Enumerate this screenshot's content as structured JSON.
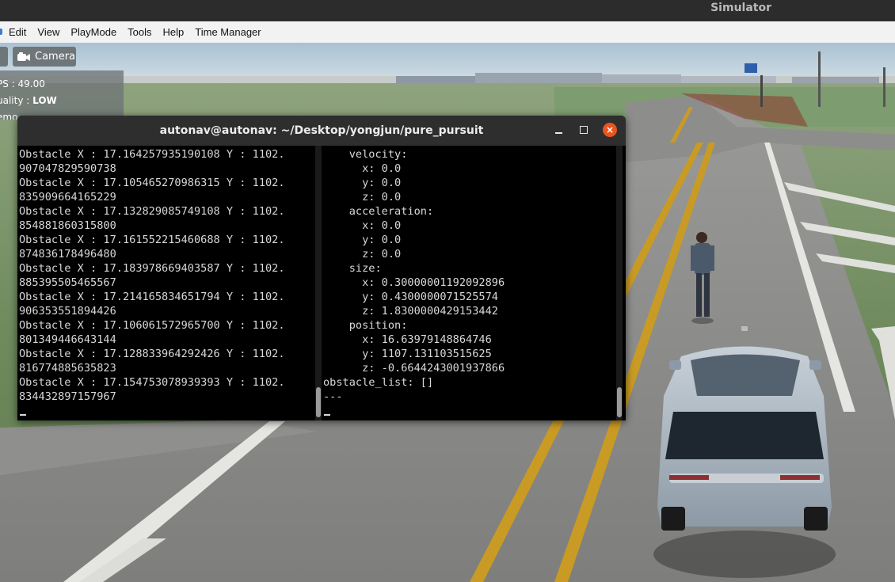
{
  "system": {
    "app_title": "Simulator"
  },
  "menu": {
    "items": [
      "Edit",
      "View",
      "PlayMode",
      "Tools",
      "Help",
      "Time Manager"
    ]
  },
  "overlay": {
    "camera_label": "Camera",
    "fps_label": "PS : ",
    "fps_value": "49.00",
    "quality_label": "uality : ",
    "quality_value": "LOW",
    "memory_label": "emo"
  },
  "terminal": {
    "title": "autonav@autonav: ~/Desktop/yongjun/pure_pursuit",
    "left_pane_lines": [
      "Obstacle X : 17.164257935190108 Y : 1102.",
      "907047829590738",
      "Obstacle X : 17.105465270986315 Y : 1102.",
      "835909664165229",
      "Obstacle X : 17.132829085749108 Y : 1102.",
      "854881860315800",
      "Obstacle X : 17.161552215460688 Y : 1102.",
      "874836178496480",
      "Obstacle X : 17.183978669403587 Y : 1102.",
      "885395505465567",
      "Obstacle X : 17.214165834651794 Y : 1102.",
      "906353551894426",
      "Obstacle X : 17.106061572965700 Y : 1102.",
      "801349446643144",
      "Obstacle X : 17.128833964292426 Y : 1102.",
      "816774885635823",
      "Obstacle X : 17.154753078939393 Y : 1102.",
      "834432897157967"
    ],
    "right_pane_lines": [
      "    velocity:",
      "      x: 0.0",
      "      y: 0.0",
      "      z: 0.0",
      "    acceleration:",
      "      x: 0.0",
      "      y: 0.0",
      "      z: 0.0",
      "    size:",
      "      x: 0.30000001192092896",
      "      y: 0.4300000071525574",
      "      z: 1.8300000429153442",
      "    position:",
      "      x: 16.63979148864746",
      "      y: 1107.131103515625",
      "      z: -0.6644243001937866",
      "obstacle_list: []",
      "---"
    ]
  }
}
